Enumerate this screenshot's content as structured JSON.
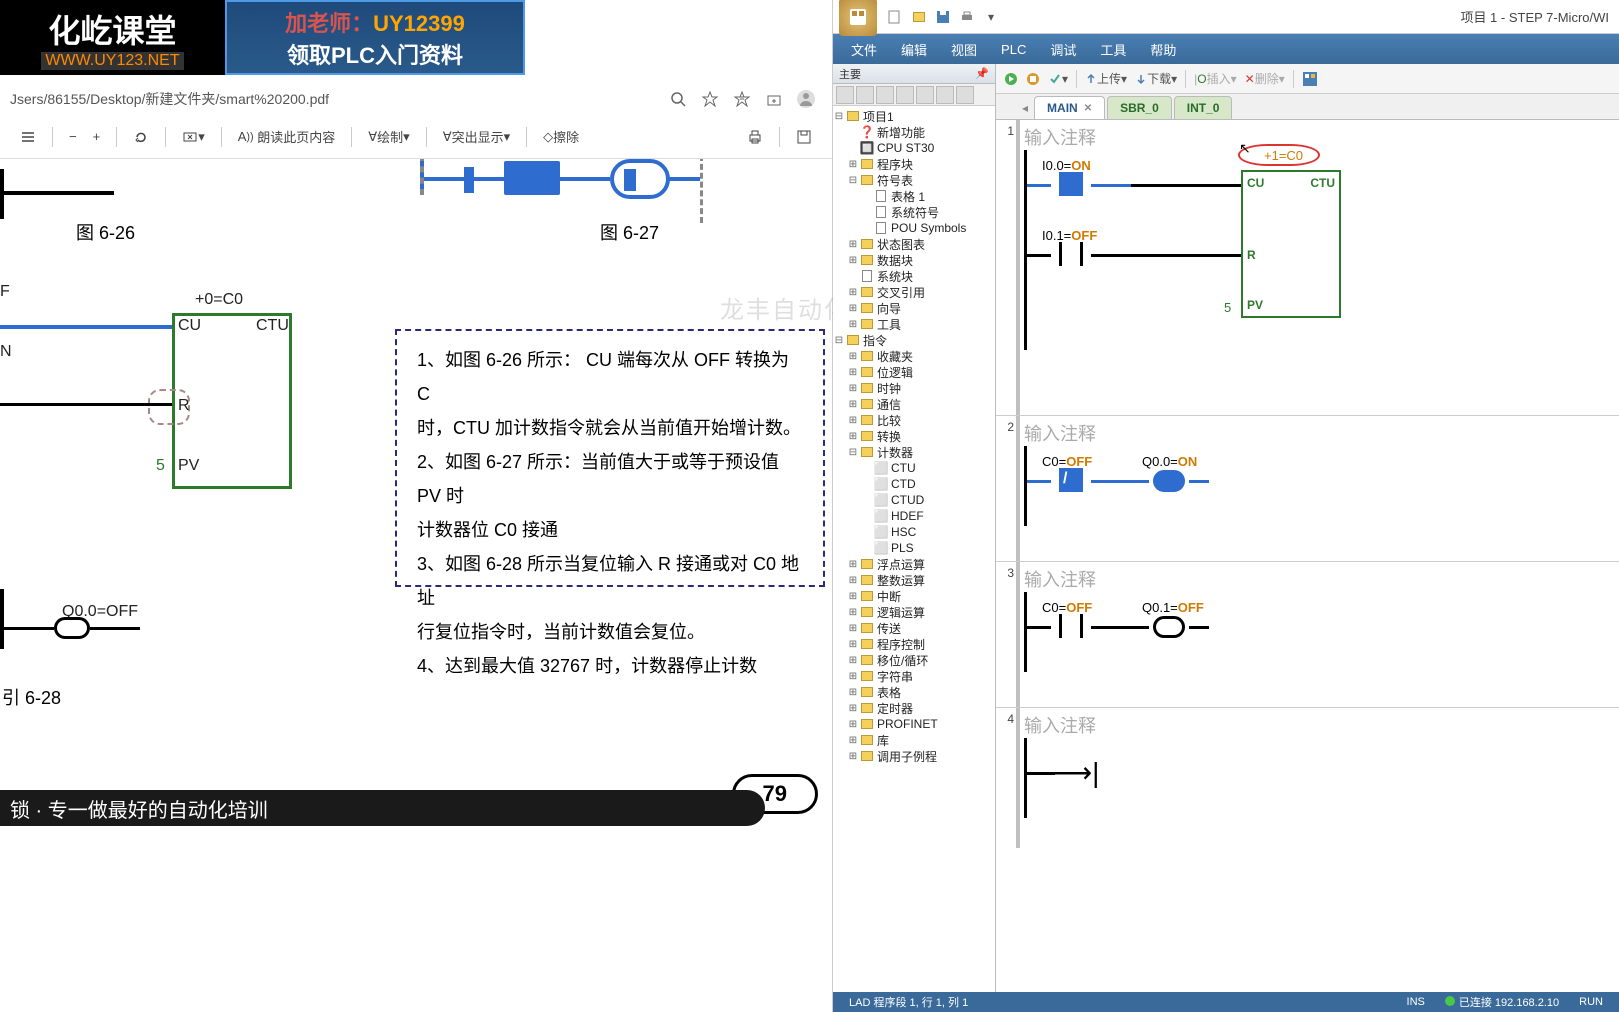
{
  "logos": {
    "logo1_top": "化屹课堂",
    "logo1_bot": "WWW.UY123.NET",
    "logo2_l1_pre": "加老师：",
    "logo2_l1_id": "UY12399",
    "logo2_l2": "领取PLC入门资料"
  },
  "pdf": {
    "url": "Jsers/86155/Desktop/新建文件夹/smart%20200.pdf",
    "toolbar": {
      "read": "朗读此页内容",
      "draw": "绘制",
      "highlight": "突出显示",
      "erase": "擦除"
    },
    "fig626": "图 6-26",
    "fig627": "图 6-27",
    "fig628": "引 6-28",
    "ctu_top": "+0=C0",
    "ctu_cu": "CU",
    "ctu_ctu": "CTU",
    "ctu_r": "R",
    "ctu_pv_val": "5",
    "ctu_pv": "PV",
    "ctu_n_left": "N",
    "ctu_f": "F",
    "text1": "1、如图 6-26 所示： CU 端每次从 OFF 转换为 C",
    "text2": "时，CTU 加计数指令就会从当前值开始增计数。",
    "text3": "2、如图 6-27 所示：当前值大于或等于预设值 PV 时",
    "text4": "计数器位 C0 接通",
    "text5": "3、如图 6-28 所示当复位输入 R 接通或对 C0 地址",
    "text6": "行复位指令时，当前计数值会复位。",
    "text7": "4、达到最大值 32767 时，计数器停止计数",
    "q00": "Q0.0=OFF",
    "pagenum": "79",
    "bottom": "锁 · 专一做最好的自动化培训"
  },
  "wm": "龙丰自动化培训中心",
  "ide": {
    "title": "项目 1 - STEP 7-Micro/WI",
    "menu": [
      "文件",
      "编辑",
      "视图",
      "PLC",
      "调试",
      "工具",
      "帮助"
    ],
    "tb": {
      "upload": "上传",
      "download": "下载",
      "insert": "插入",
      "delete": "删除"
    },
    "panel_main": "主要",
    "tree": {
      "root": "项目1",
      "newfn": "新增功能",
      "cpu": "CPU ST30",
      "progblk": "程序块",
      "symtable": "符号表",
      "tab1": "表格 1",
      "syssym": "系统符号",
      "pousym": "POU Symbols",
      "statchart": "状态图表",
      "datablk": "数据块",
      "sysblk": "系统块",
      "xref": "交叉引用",
      "wizard": "向导",
      "tools": "工具",
      "instructions": "指令",
      "fav": "收藏夹",
      "bitlogic": "位逻辑",
      "clock": "时钟",
      "comm": "通信",
      "compare": "比较",
      "convert": "转换",
      "counter": "计数器",
      "ctu": "CTU",
      "ctd": "CTD",
      "ctud": "CTUD",
      "hdef": "HDEF",
      "hsc": "HSC",
      "pls": "PLS",
      "float": "浮点运算",
      "int": "整数运算",
      "interrupt": "中断",
      "logic": "逻辑运算",
      "move": "传送",
      "progctl": "程序控制",
      "shift": "移位/循环",
      "string": "字符串",
      "table": "表格",
      "timer": "定时器",
      "profinet": "PROFINET",
      "lib": "库",
      "subr": "调用子例程"
    },
    "tabs": {
      "main": "MAIN",
      "sbr": "SBR_0",
      "int": "INT_0"
    },
    "networks": {
      "comment_placeholder": "输入注释",
      "n1": {
        "i00": "I0.0=",
        "i00v": "ON",
        "c0": "+1=C0",
        "i01": "I0.1=",
        "i01v": "OFF",
        "cu": "CU",
        "ctu": "CTU",
        "r": "R",
        "pv": "PV",
        "pvval": "5"
      },
      "n2": {
        "c0": "C0=",
        "c0v": "OFF",
        "q00": "Q0.0=",
        "q00v": "ON"
      },
      "n3": {
        "c0": "C0=",
        "c0v": "OFF",
        "q01": "Q0.1=",
        "q01v": "OFF"
      }
    },
    "status": {
      "lad": "LAD 程序段 1, 行 1, 列 1",
      "ins": "INS",
      "conn": "已连接 192.168.2.10",
      "run": "RUN"
    }
  }
}
